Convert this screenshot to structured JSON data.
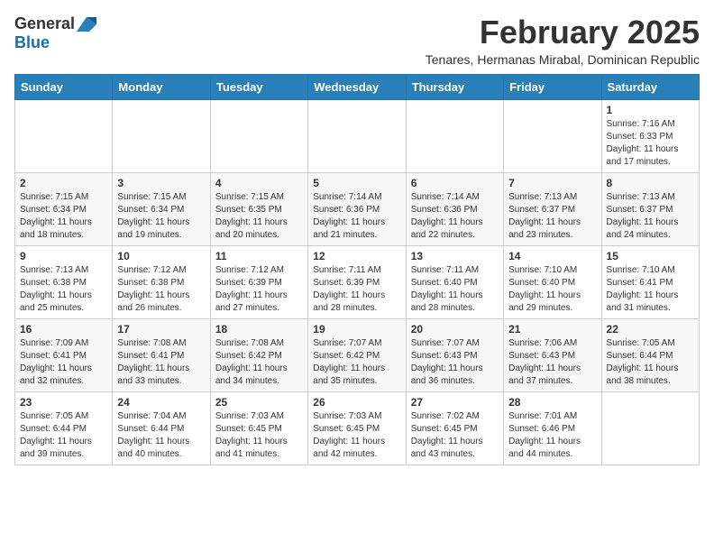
{
  "header": {
    "logo_general": "General",
    "logo_blue": "Blue",
    "month_title": "February 2025",
    "subtitle": "Tenares, Hermanas Mirabal, Dominican Republic"
  },
  "calendar": {
    "days_of_week": [
      "Sunday",
      "Monday",
      "Tuesday",
      "Wednesday",
      "Thursday",
      "Friday",
      "Saturday"
    ],
    "weeks": [
      [
        {
          "day": "",
          "info": ""
        },
        {
          "day": "",
          "info": ""
        },
        {
          "day": "",
          "info": ""
        },
        {
          "day": "",
          "info": ""
        },
        {
          "day": "",
          "info": ""
        },
        {
          "day": "",
          "info": ""
        },
        {
          "day": "1",
          "info": "Sunrise: 7:16 AM\nSunset: 6:33 PM\nDaylight: 11 hours\nand 17 minutes."
        }
      ],
      [
        {
          "day": "2",
          "info": "Sunrise: 7:15 AM\nSunset: 6:34 PM\nDaylight: 11 hours\nand 18 minutes."
        },
        {
          "day": "3",
          "info": "Sunrise: 7:15 AM\nSunset: 6:34 PM\nDaylight: 11 hours\nand 19 minutes."
        },
        {
          "day": "4",
          "info": "Sunrise: 7:15 AM\nSunset: 6:35 PM\nDaylight: 11 hours\nand 20 minutes."
        },
        {
          "day": "5",
          "info": "Sunrise: 7:14 AM\nSunset: 6:36 PM\nDaylight: 11 hours\nand 21 minutes."
        },
        {
          "day": "6",
          "info": "Sunrise: 7:14 AM\nSunset: 6:36 PM\nDaylight: 11 hours\nand 22 minutes."
        },
        {
          "day": "7",
          "info": "Sunrise: 7:13 AM\nSunset: 6:37 PM\nDaylight: 11 hours\nand 23 minutes."
        },
        {
          "day": "8",
          "info": "Sunrise: 7:13 AM\nSunset: 6:37 PM\nDaylight: 11 hours\nand 24 minutes."
        }
      ],
      [
        {
          "day": "9",
          "info": "Sunrise: 7:13 AM\nSunset: 6:38 PM\nDaylight: 11 hours\nand 25 minutes."
        },
        {
          "day": "10",
          "info": "Sunrise: 7:12 AM\nSunset: 6:38 PM\nDaylight: 11 hours\nand 26 minutes."
        },
        {
          "day": "11",
          "info": "Sunrise: 7:12 AM\nSunset: 6:39 PM\nDaylight: 11 hours\nand 27 minutes."
        },
        {
          "day": "12",
          "info": "Sunrise: 7:11 AM\nSunset: 6:39 PM\nDaylight: 11 hours\nand 28 minutes."
        },
        {
          "day": "13",
          "info": "Sunrise: 7:11 AM\nSunset: 6:40 PM\nDaylight: 11 hours\nand 28 minutes."
        },
        {
          "day": "14",
          "info": "Sunrise: 7:10 AM\nSunset: 6:40 PM\nDaylight: 11 hours\nand 29 minutes."
        },
        {
          "day": "15",
          "info": "Sunrise: 7:10 AM\nSunset: 6:41 PM\nDaylight: 11 hours\nand 31 minutes."
        }
      ],
      [
        {
          "day": "16",
          "info": "Sunrise: 7:09 AM\nSunset: 6:41 PM\nDaylight: 11 hours\nand 32 minutes."
        },
        {
          "day": "17",
          "info": "Sunrise: 7:08 AM\nSunset: 6:41 PM\nDaylight: 11 hours\nand 33 minutes."
        },
        {
          "day": "18",
          "info": "Sunrise: 7:08 AM\nSunset: 6:42 PM\nDaylight: 11 hours\nand 34 minutes."
        },
        {
          "day": "19",
          "info": "Sunrise: 7:07 AM\nSunset: 6:42 PM\nDaylight: 11 hours\nand 35 minutes."
        },
        {
          "day": "20",
          "info": "Sunrise: 7:07 AM\nSunset: 6:43 PM\nDaylight: 11 hours\nand 36 minutes."
        },
        {
          "day": "21",
          "info": "Sunrise: 7:06 AM\nSunset: 6:43 PM\nDaylight: 11 hours\nand 37 minutes."
        },
        {
          "day": "22",
          "info": "Sunrise: 7:05 AM\nSunset: 6:44 PM\nDaylight: 11 hours\nand 38 minutes."
        }
      ],
      [
        {
          "day": "23",
          "info": "Sunrise: 7:05 AM\nSunset: 6:44 PM\nDaylight: 11 hours\nand 39 minutes."
        },
        {
          "day": "24",
          "info": "Sunrise: 7:04 AM\nSunset: 6:44 PM\nDaylight: 11 hours\nand 40 minutes."
        },
        {
          "day": "25",
          "info": "Sunrise: 7:03 AM\nSunset: 6:45 PM\nDaylight: 11 hours\nand 41 minutes."
        },
        {
          "day": "26",
          "info": "Sunrise: 7:03 AM\nSunset: 6:45 PM\nDaylight: 11 hours\nand 42 minutes."
        },
        {
          "day": "27",
          "info": "Sunrise: 7:02 AM\nSunset: 6:45 PM\nDaylight: 11 hours\nand 43 minutes."
        },
        {
          "day": "28",
          "info": "Sunrise: 7:01 AM\nSunset: 6:46 PM\nDaylight: 11 hours\nand 44 minutes."
        },
        {
          "day": "",
          "info": ""
        }
      ]
    ]
  }
}
